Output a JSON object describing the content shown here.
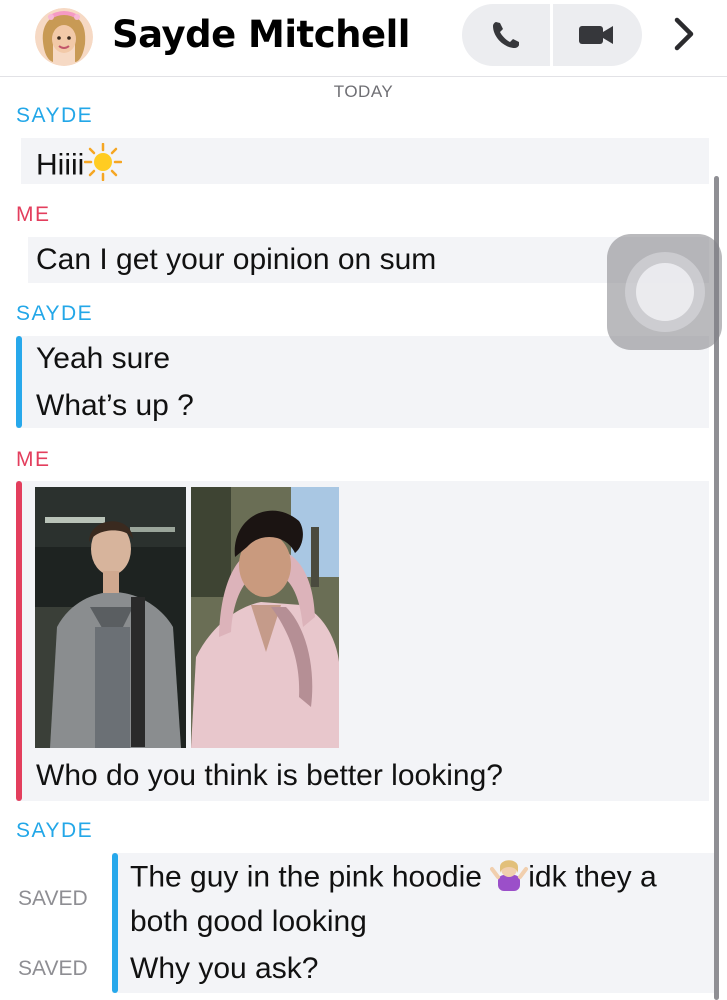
{
  "header": {
    "contact_name": "Sayde Mitchell",
    "call_icon": "phone-icon",
    "video_icon": "video-camera-icon",
    "more_icon": "chevron-right-icon"
  },
  "conversation": {
    "date_divider": "TODAY",
    "groups": [
      {
        "sender": "SAYDE",
        "messages": [
          "Hiiii"
        ],
        "emoji": "sun-emoji"
      },
      {
        "sender": "ME",
        "messages": [
          "Can I get your opinion on sum"
        ]
      },
      {
        "sender": "SAYDE",
        "messages": [
          "Yeah sure",
          "What’s up ?"
        ]
      },
      {
        "sender": "ME",
        "attachments": [
          "photo-grey-hoodie",
          "photo-pink-hoodie"
        ],
        "messages": [
          "Who do you think is better looking?"
        ]
      },
      {
        "sender": "SAYDE",
        "saved_label": "SAVED",
        "messages": [
          "The guy in the pink hoodie",
          "idk they a",
          "both good looking",
          "Why you ask?"
        ],
        "emoji": "shrug-emoji"
      }
    ]
  },
  "colors": {
    "them": "#23a7e8",
    "me": "#e33e5d",
    "bubble": "#f3f4f7",
    "saved": "#8e8e93"
  }
}
